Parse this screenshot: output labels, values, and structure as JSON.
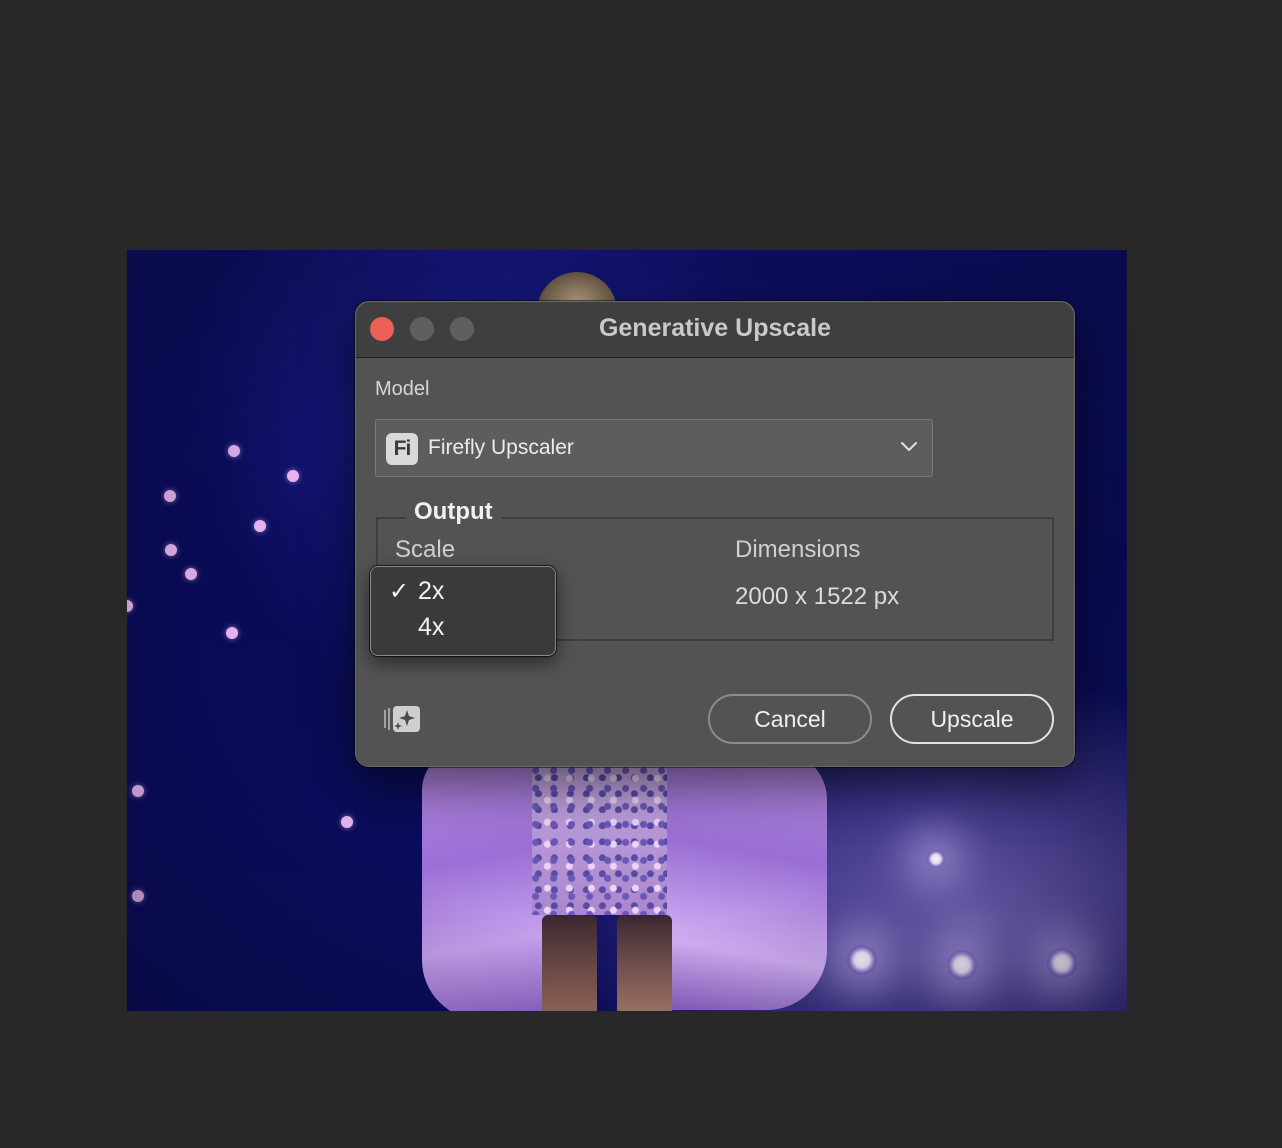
{
  "dialog": {
    "title": "Generative Upscale",
    "model_label": "Model",
    "model": {
      "badge": "Fi",
      "value": "Firefly Upscaler"
    },
    "output": {
      "legend": "Output",
      "scale_label": "Scale",
      "dimensions_label": "Dimensions",
      "dimensions_value": "2000 x 1522 px"
    },
    "scale_menu": {
      "check_glyph": "✓",
      "items": [
        {
          "label": "2x",
          "checked": true
        },
        {
          "label": "4x",
          "checked": false
        }
      ]
    },
    "buttons": {
      "cancel": "Cancel",
      "primary": "Upscale"
    }
  },
  "icons": {
    "close": "close-traffic-light",
    "minimize": "minimize-traffic-light",
    "zoom": "zoom-traffic-light",
    "dropdown": "chevron-down-icon",
    "effects": "sparkle-icon"
  },
  "colors": {
    "close_button": "#ec5f57",
    "dialog_bg": "#535353",
    "titlebar_bg": "#3f3f3f",
    "menu_bg": "#3a3a3a",
    "app_bg": "#282828"
  }
}
